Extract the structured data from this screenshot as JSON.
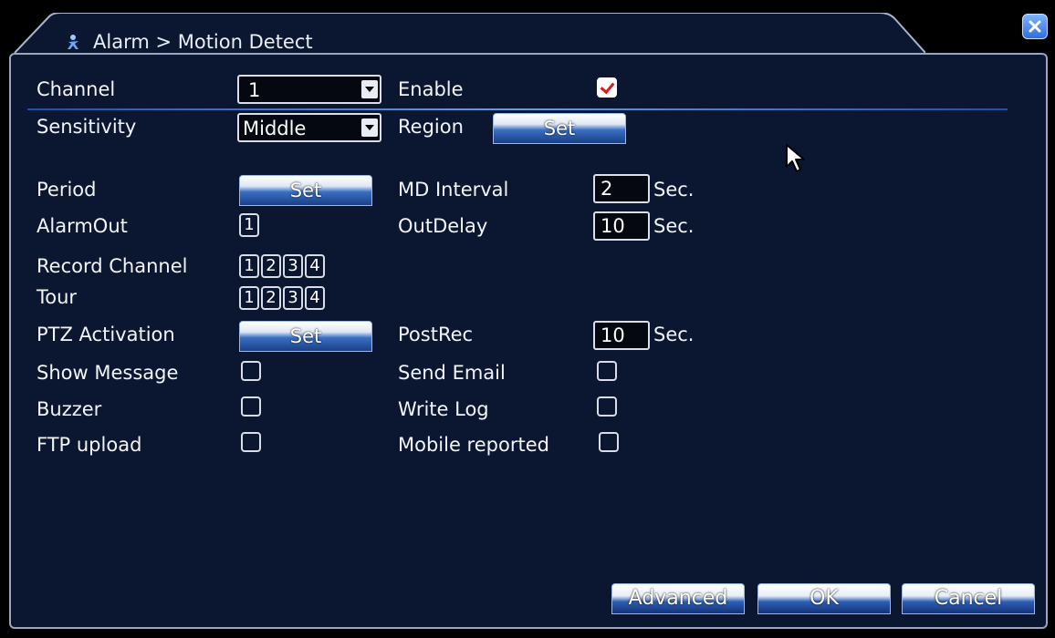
{
  "window": {
    "title": "Alarm > Motion Detect"
  },
  "form": {
    "channel_label": "Channel",
    "channel_value": "1",
    "enable_label": "Enable",
    "enable_checked": true,
    "sensitivity_label": "Sensitivity",
    "sensitivity_value": "Middle",
    "region_label": "Region",
    "region_button": "Set",
    "period_label": "Period",
    "period_button": "Set",
    "md_interval_label": "MD Interval",
    "md_interval_value": "2",
    "md_interval_unit": "Sec.",
    "alarmout_label": "AlarmOut",
    "alarmout_channels": [
      "1"
    ],
    "outdelay_label": "OutDelay",
    "outdelay_value": "10",
    "outdelay_unit": "Sec.",
    "record_channel_label": "Record Channel",
    "record_channels": [
      "1",
      "2",
      "3",
      "4"
    ],
    "tour_label": "Tour",
    "tour_channels": [
      "1",
      "2",
      "3",
      "4"
    ],
    "ptz_label": "PTZ Activation",
    "ptz_button": "Set",
    "postrec_label": "PostRec",
    "postrec_value": "10",
    "postrec_unit": "Sec.",
    "show_message_label": "Show Message",
    "send_email_label": "Send Email",
    "buzzer_label": "Buzzer",
    "write_log_label": "Write Log",
    "ftp_upload_label": "FTP upload",
    "mobile_reported_label": "Mobile reported"
  },
  "footer": {
    "advanced_label": "Advanced",
    "ok_label": "OK",
    "cancel_label": "Cancel"
  },
  "icons": {
    "title": "person-icon",
    "close": "close-icon",
    "cursor": "mouse-pointer-icon"
  },
  "colors": {
    "panel_bg": "#0b1631",
    "accent": "#2d6de0",
    "check_mark": "#e01818"
  }
}
